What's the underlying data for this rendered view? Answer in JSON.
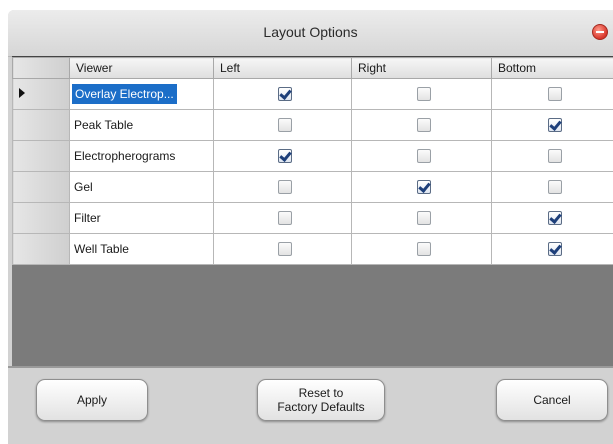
{
  "dialog": {
    "title": "Layout Options"
  },
  "grid": {
    "columns": [
      "Viewer",
      "Left",
      "Right",
      "Bottom"
    ],
    "current_row_index": 0,
    "rows": [
      {
        "viewer": "Overlay Electrop...",
        "selected": true,
        "left": true,
        "right": false,
        "bottom": false
      },
      {
        "viewer": "Peak Table",
        "selected": false,
        "left": false,
        "right": false,
        "bottom": true
      },
      {
        "viewer": "Electropherograms",
        "selected": false,
        "left": true,
        "right": false,
        "bottom": false
      },
      {
        "viewer": "Gel",
        "selected": false,
        "left": false,
        "right": true,
        "bottom": false
      },
      {
        "viewer": "Filter",
        "selected": false,
        "left": false,
        "right": false,
        "bottom": true
      },
      {
        "viewer": "Well Table",
        "selected": false,
        "left": false,
        "right": false,
        "bottom": true
      }
    ]
  },
  "buttons": {
    "apply": "Apply",
    "reset": "Reset to\nFactory Defaults",
    "cancel": "Cancel"
  },
  "colors": {
    "selection": "#1c6ec8",
    "grid_background": "#7b7b7b",
    "dialog_background": "#d2d2d2"
  },
  "icons": {
    "close": "close-icon",
    "current_row": "row-pointer-icon"
  }
}
